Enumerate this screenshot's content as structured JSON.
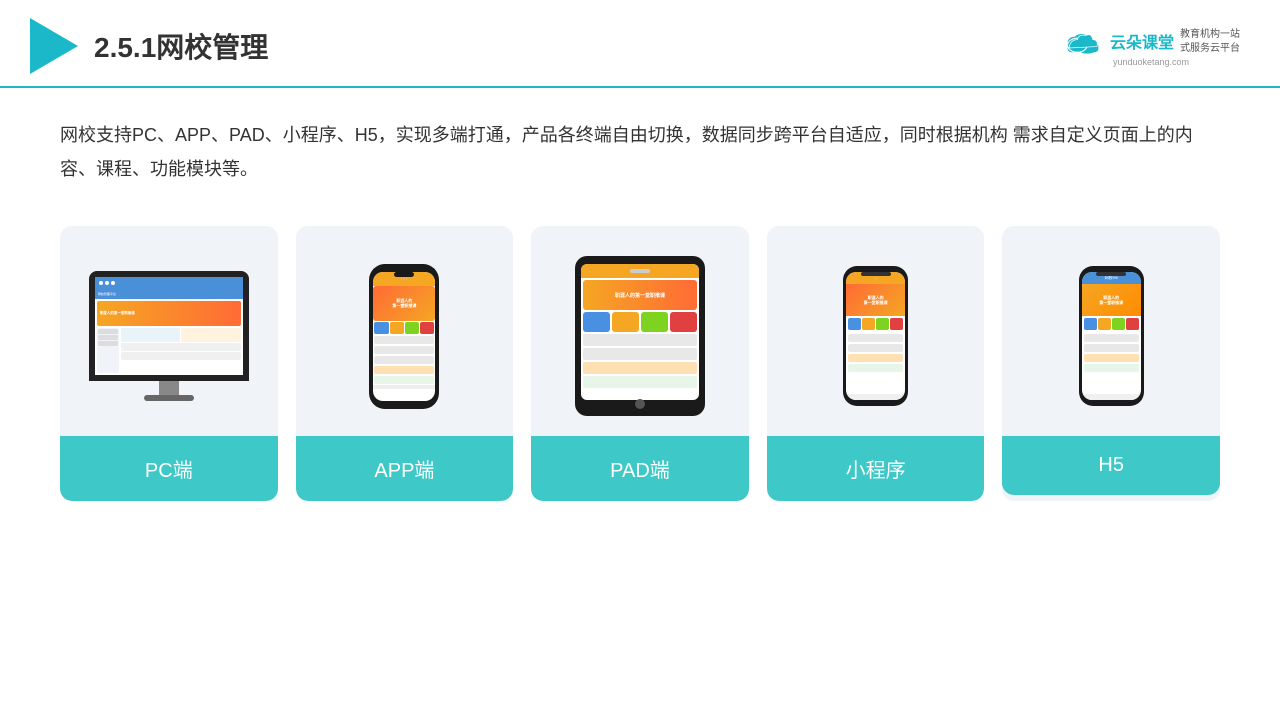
{
  "header": {
    "title": "2.5.1网校管理",
    "brand": {
      "name": "云朵课堂",
      "url": "yunduoketang.com",
      "slogan": "教育机构一站\n式服务云平台"
    }
  },
  "description": "网校支持PC、APP、PAD、小程序、H5，实现多端打通，产品各终端自由切换，数据同步跨平台自适应，同时根据机构\n需求自定义页面上的内容、课程、功能模块等。",
  "cards": [
    {
      "id": "pc",
      "label": "PC端"
    },
    {
      "id": "app",
      "label": "APP端"
    },
    {
      "id": "pad",
      "label": "PAD端"
    },
    {
      "id": "miniprogram",
      "label": "小程序"
    },
    {
      "id": "h5",
      "label": "H5"
    }
  ]
}
